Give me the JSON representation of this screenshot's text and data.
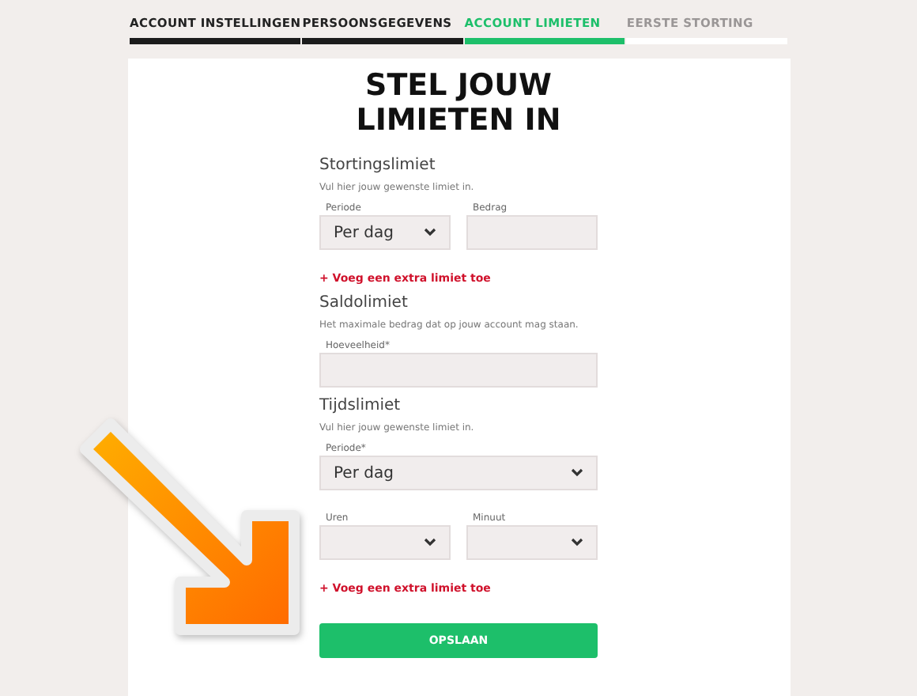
{
  "steps": [
    {
      "label": "ACCOUNT INSTELLINGEN",
      "completed": true,
      "selected": false
    },
    {
      "label": "PERSOONSGEGEVENS",
      "completed": true,
      "selected": false
    },
    {
      "label": "ACCOUNT LIMIETEN",
      "completed": false,
      "selected": true
    },
    {
      "label": "EERSTE STORTING",
      "completed": false,
      "selected": false
    }
  ],
  "title": "STEL JOUW\nLIMIETEN IN",
  "sections": [
    {
      "title": "Stortingslimiet",
      "hint": "Vul hier jouw gewenste limiet in.",
      "rows": [
        [
          {
            "kind": "select",
            "label": "Periode",
            "value": "Per dag"
          },
          {
            "kind": "input",
            "label": "Bedrag"
          }
        ]
      ],
      "add_link": "+ Voeg een extra limiet toe"
    },
    {
      "title": "Saldolimiet",
      "hint": "Het maximale bedrag dat op jouw account mag staan.",
      "rows": [
        [
          {
            "kind": "input",
            "label": "Hoeveelheid*"
          }
        ]
      ]
    },
    {
      "title": "Tijdslimiet",
      "hint": "Vul hier jouw gewenste limiet in.",
      "rows": [
        [
          {
            "kind": "select",
            "label": "Periode*",
            "value": "Per dag"
          }
        ],
        [
          {
            "kind": "select",
            "label": "Uren"
          },
          {
            "kind": "select",
            "label": "Minuut"
          }
        ]
      ],
      "add_link": "+ Voeg een extra limiet toe"
    }
  ],
  "save_button": "OPSLAAN"
}
